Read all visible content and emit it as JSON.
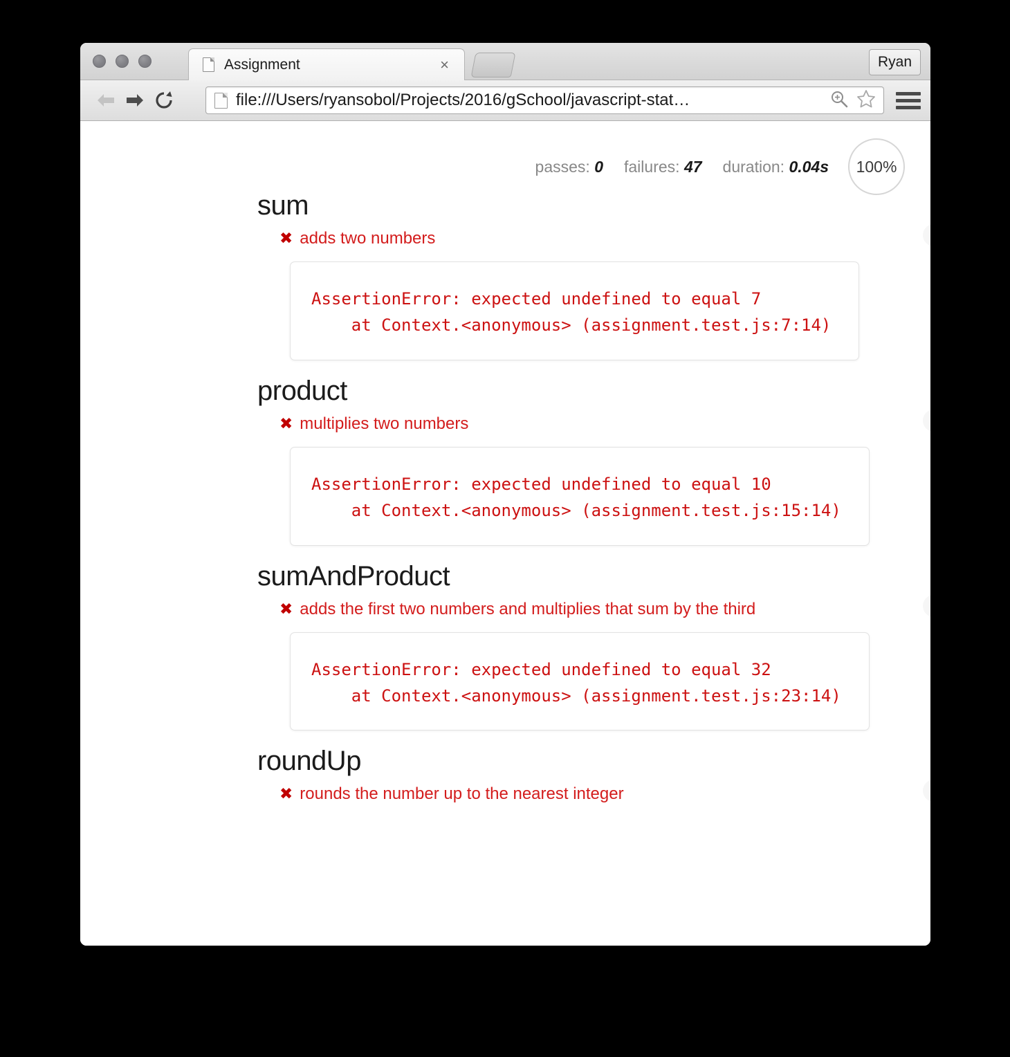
{
  "window": {
    "tab": {
      "title": "Assignment",
      "close_label": "×",
      "favicon": "document-icon"
    },
    "new_tab_label": "",
    "profile_label": "Ryan"
  },
  "toolbar": {
    "back_label": "back-arrow-icon",
    "forward_label": "forward-arrow-icon",
    "reload_label": "reload-icon",
    "url": "file:///Users/ryansobol/Projects/2016/gSchool/javascript-stat…",
    "zoom_icon": "zoom-in-icon",
    "bookmark_icon": "star-icon",
    "menu_icon": "hamburger-menu-icon"
  },
  "report": {
    "stats": {
      "passes_label": "passes:",
      "passes_value": "0",
      "failures_label": "failures:",
      "failures_value": "47",
      "duration_label": "duration:",
      "duration_value": "0.04s",
      "progress": "100%"
    },
    "fail_mark": "✖",
    "suites": [
      {
        "title": "sum",
        "tests": [
          {
            "title": "adds two numbers",
            "error": "AssertionError: expected undefined to equal 7\n    at Context.<anonymous> (assignment.test.js:7:14)"
          }
        ]
      },
      {
        "title": "product",
        "tests": [
          {
            "title": "multiplies two numbers",
            "error": "AssertionError: expected undefined to equal 10\n    at Context.<anonymous> (assignment.test.js:15:14)"
          }
        ]
      },
      {
        "title": "sumAndProduct",
        "tests": [
          {
            "title": "adds the first two numbers and multiplies that sum by the third",
            "error": "AssertionError: expected undefined to equal 32\n    at Context.<anonymous> (assignment.test.js:23:14)"
          }
        ]
      },
      {
        "title": "roundUp",
        "tests": [
          {
            "title": "rounds the number up to the nearest integer",
            "error": null
          }
        ]
      }
    ]
  },
  "colors": {
    "fail_red": "#d31c1c",
    "error_red": "#cc1111",
    "muted_gray": "#888888"
  }
}
